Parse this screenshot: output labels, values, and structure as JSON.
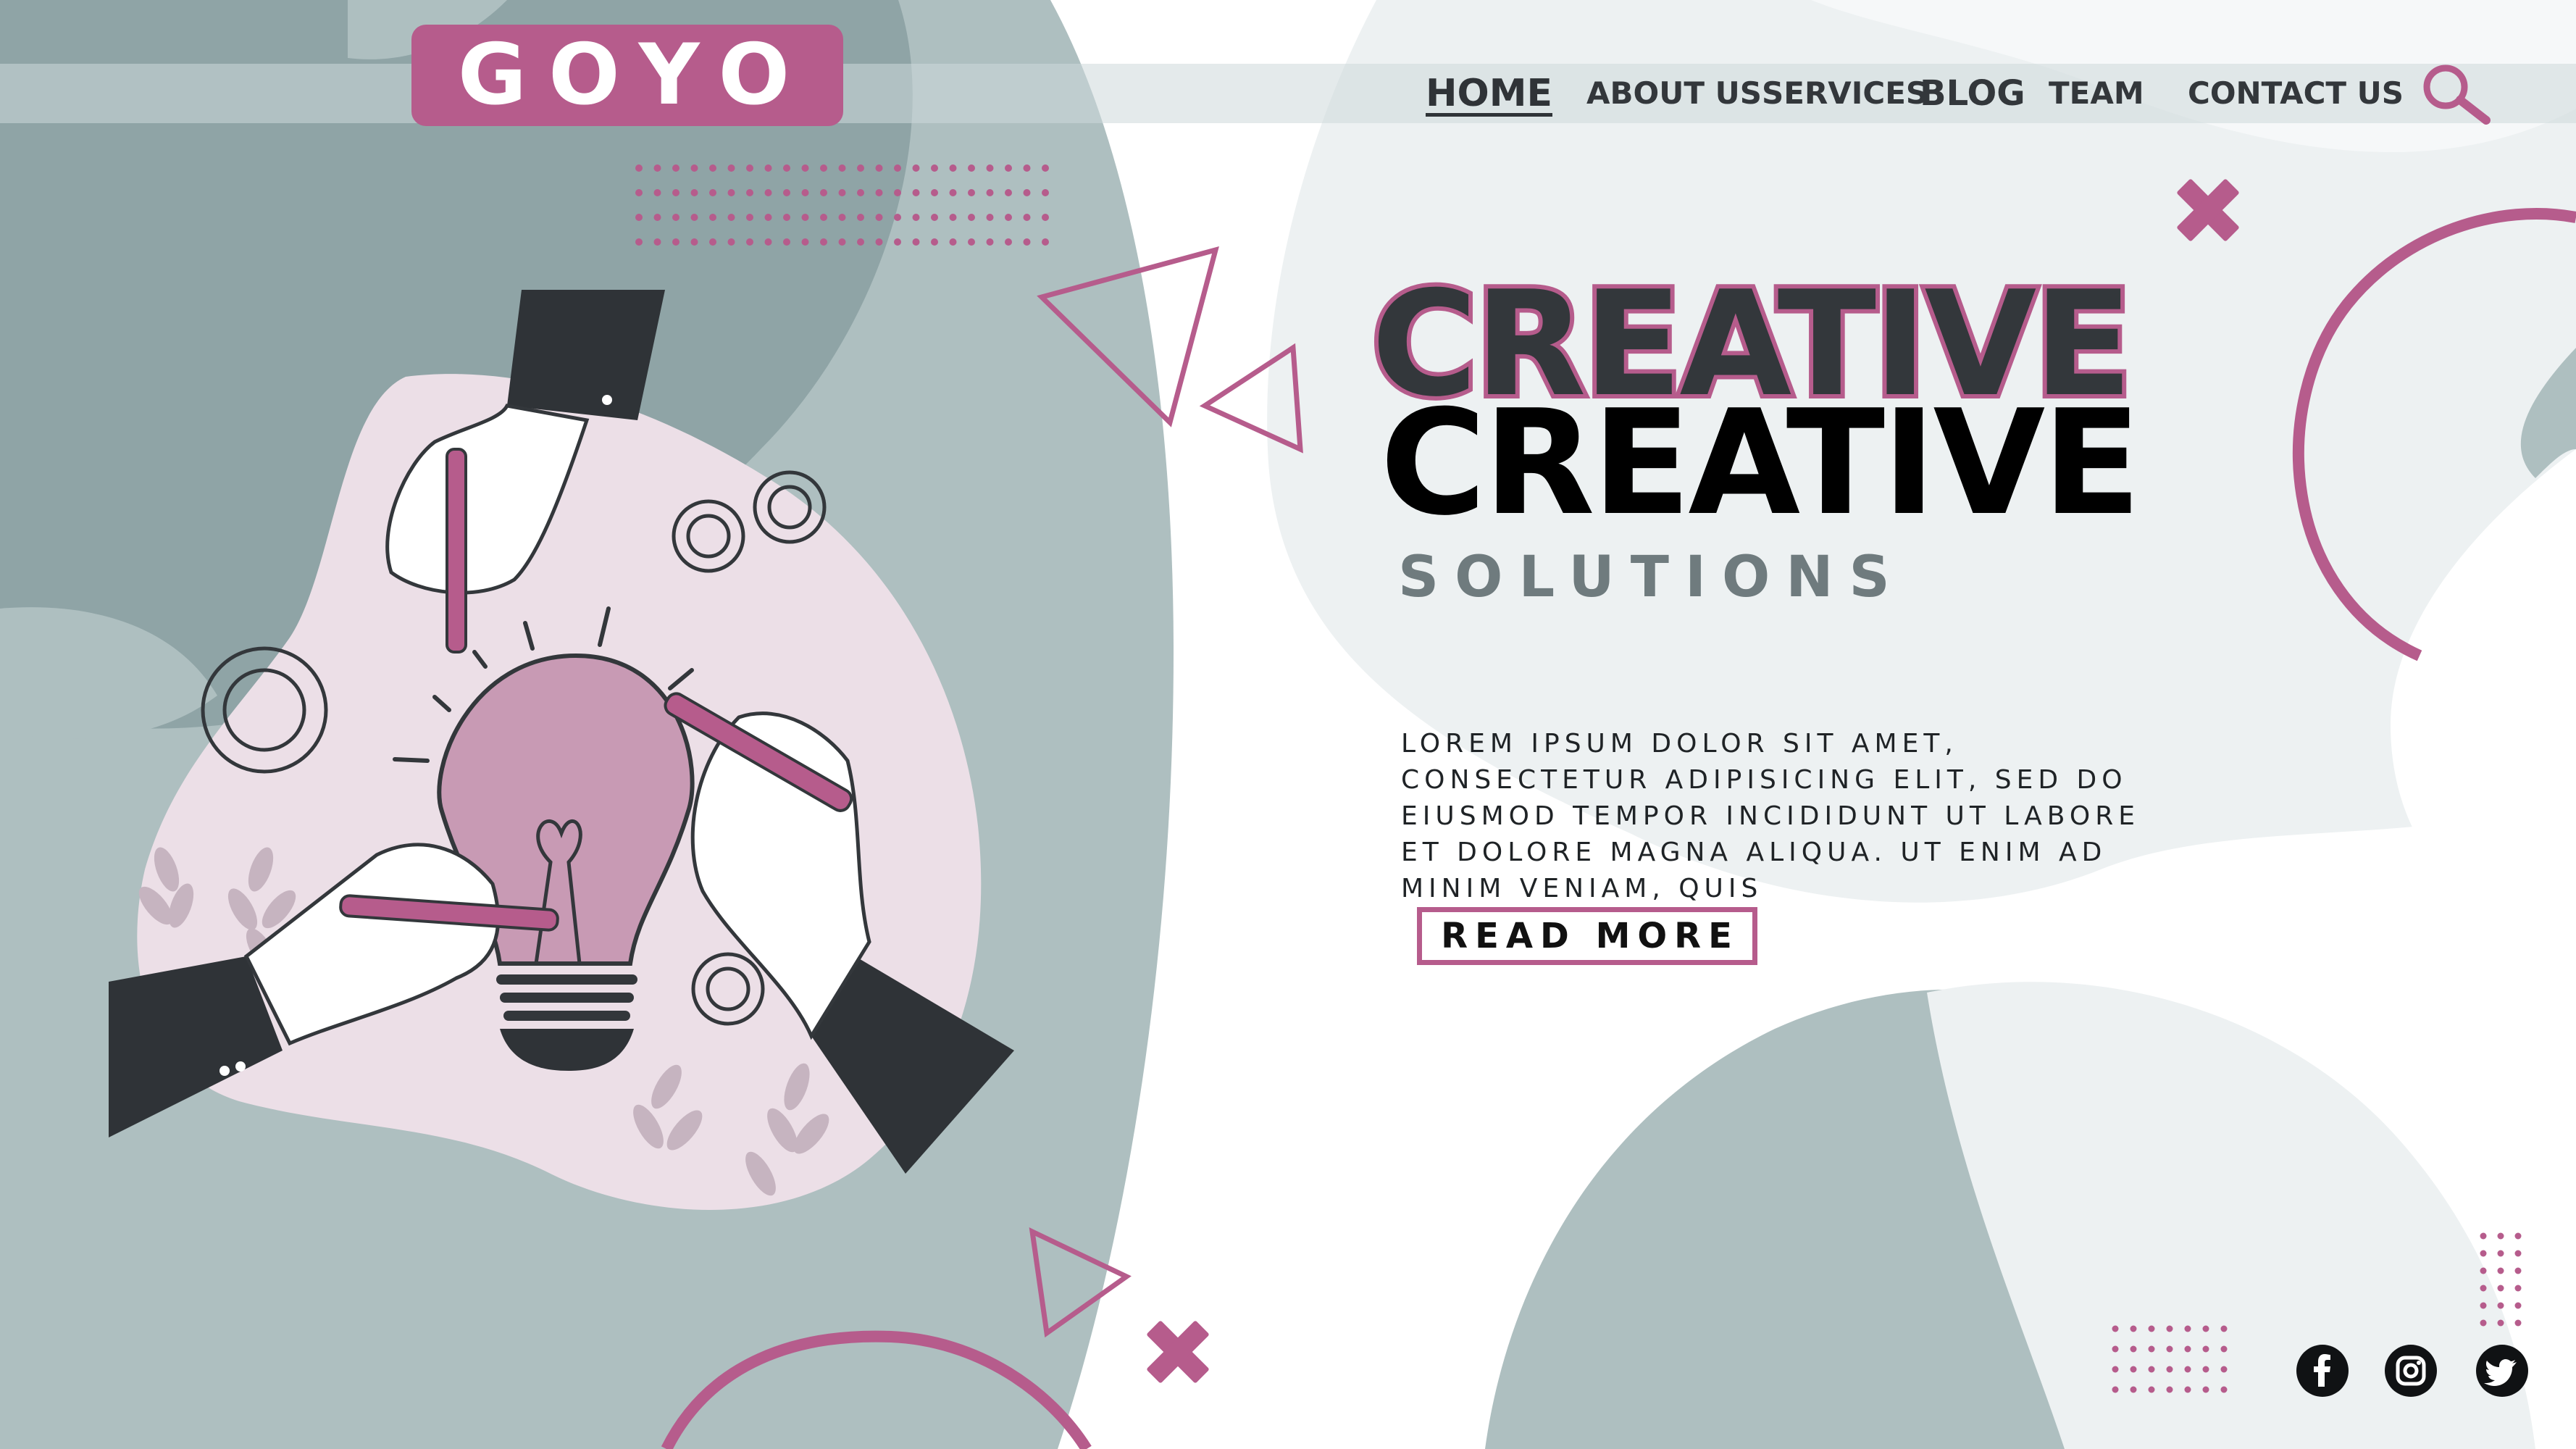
{
  "brand": {
    "name": "GOYO"
  },
  "nav": {
    "home": "HOME",
    "about": "ABOUT US",
    "services": "SERVICES",
    "blog": "BLOG",
    "team": "TEAM",
    "contact": "CONTACT US"
  },
  "hero": {
    "title_outline": "CREATIVE",
    "title": "CREATIVE",
    "subtitle": "SOLUTIONS",
    "body": "Lorem ipsum dolor sit amet, consectetur adipisicing elit, sed do eiusmod tempor incididunt ut labore et dolore magna aliqua. Ut enim ad minim veniam, quis",
    "cta": "READ MORE"
  },
  "icons": {
    "search": "search-icon",
    "facebook": "facebook-icon",
    "instagram": "instagram-icon",
    "twitter": "twitter-icon",
    "illustration": "lightbulb-hands-illustration"
  },
  "colors": {
    "accent": "#b65c8c",
    "dark": "#33373b",
    "gray_blob": "#aebfc0",
    "dark_gray_blob": "#8fa4a6",
    "light_blob": "#edf1f2",
    "pink_blob": "#ecdfe7"
  }
}
